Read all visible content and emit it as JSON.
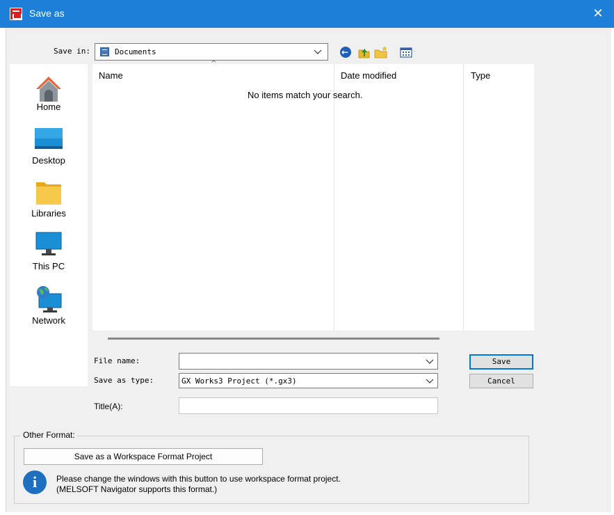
{
  "window": {
    "title": "Save as",
    "close_glyph": "✕"
  },
  "toolbar": {
    "save_in_label": "Save in:",
    "save_in_value": "Documents",
    "icons": [
      "back-icon",
      "up-folder-icon",
      "new-folder-icon",
      "view-menu-icon"
    ]
  },
  "places": [
    {
      "label": "Home",
      "icon": "home-icon"
    },
    {
      "label": "Desktop",
      "icon": "desktop-icon"
    },
    {
      "label": "Libraries",
      "icon": "libraries-icon"
    },
    {
      "label": "This PC",
      "icon": "this-pc-icon"
    },
    {
      "label": "Network",
      "icon": "network-icon"
    }
  ],
  "file_list": {
    "columns": [
      "Name",
      "Date modified",
      "Type"
    ],
    "sort_glyph": "^",
    "empty_message": "No items match your search."
  },
  "form": {
    "file_name_label": "File name:",
    "file_name_value": "",
    "save_as_type_label": "Save as type:",
    "save_as_type_value": "GX Works3 Project (*.gx3)",
    "title_label": "Title(A):",
    "title_value": ""
  },
  "buttons": {
    "save": "Save",
    "cancel": "Cancel"
  },
  "other_format": {
    "legend": "Other Format:",
    "button_label": "Save as a Workspace Format Project",
    "info_glyph": "i",
    "info_line1": "Please change the windows with this button to use workspace format project.",
    "info_line2": "(MELSOFT Navigator supports this format.)"
  },
  "colors": {
    "titlebar": "#1e7fd8",
    "dialog_bg": "#f0f0f0",
    "info_icon": "#1f6fc1",
    "default_button_border": "#0078d7"
  }
}
